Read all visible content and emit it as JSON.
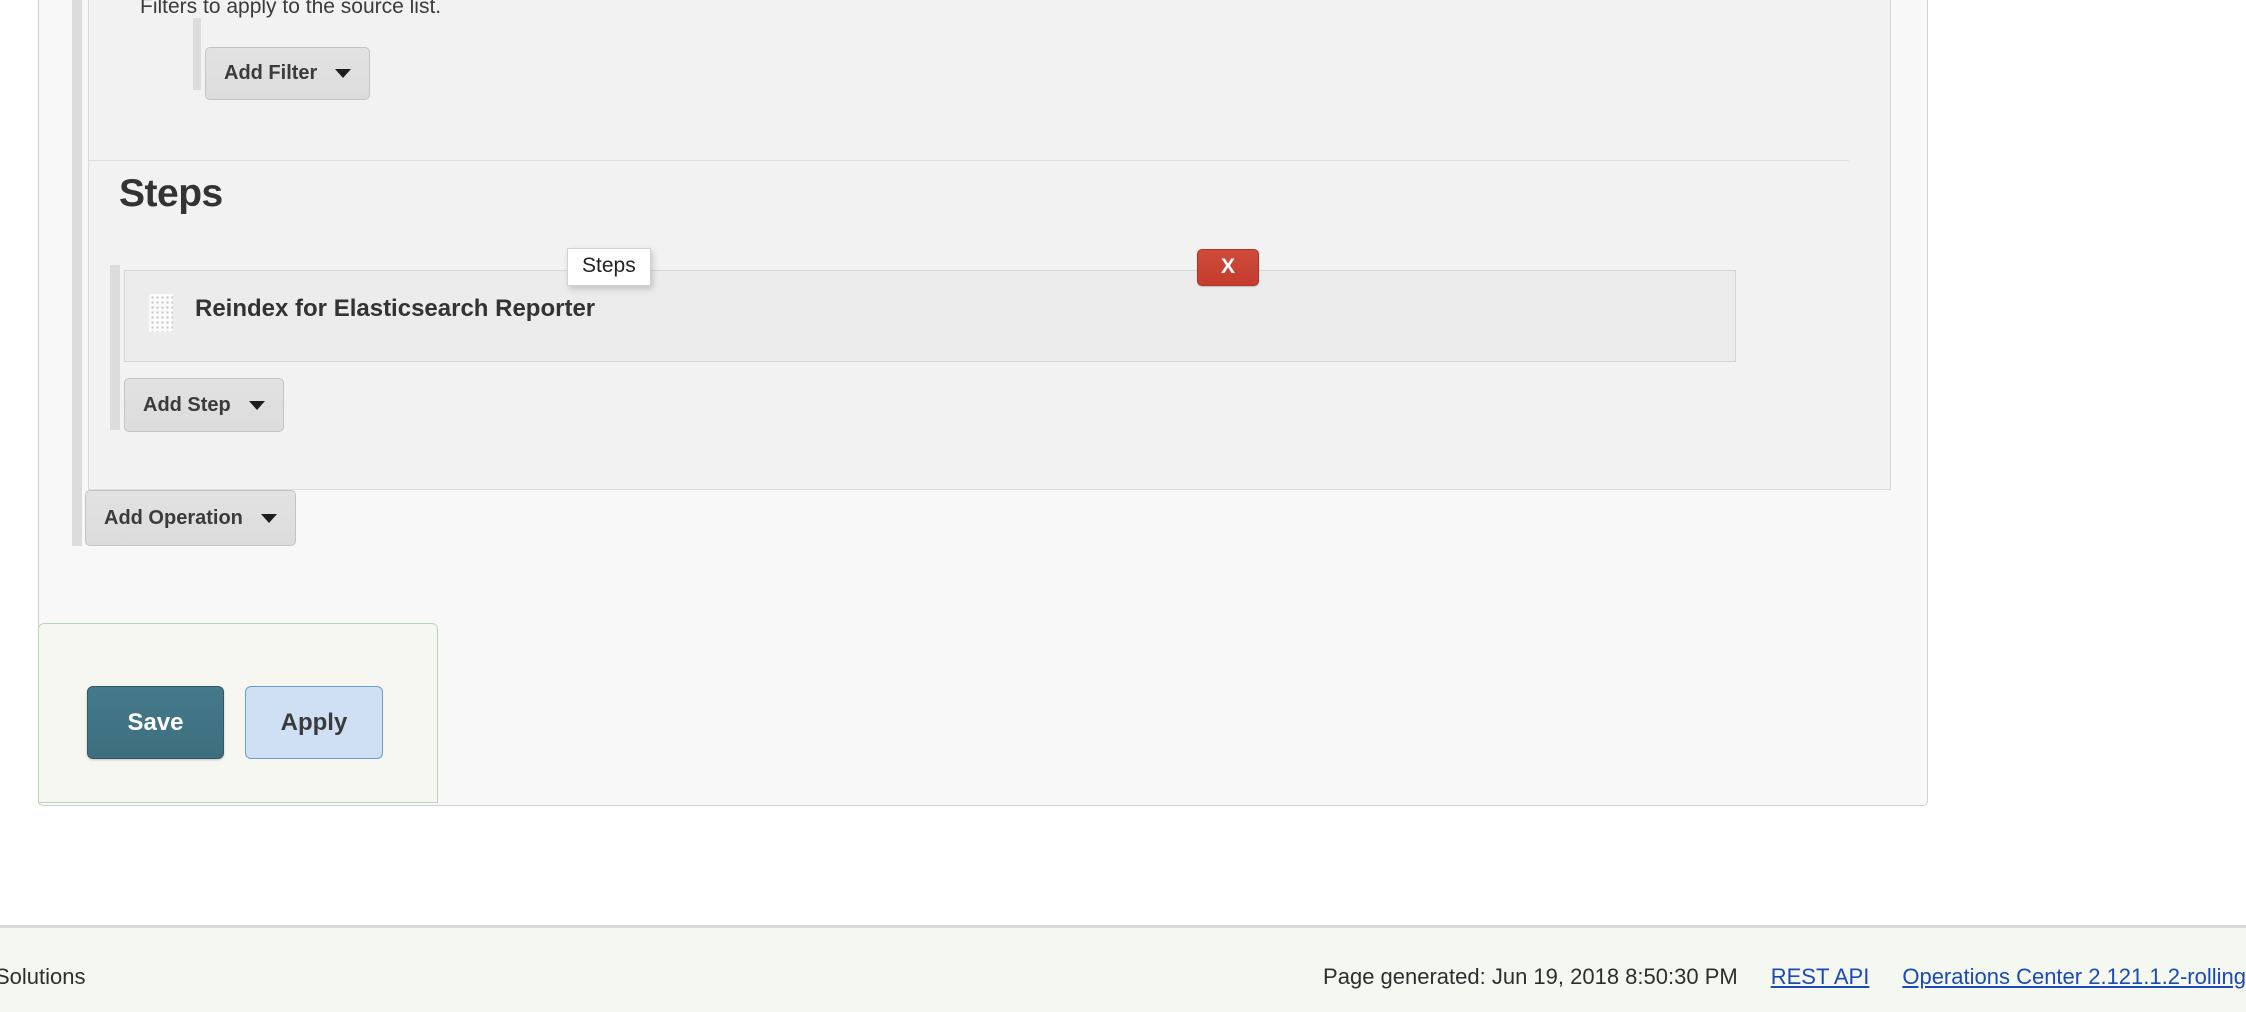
{
  "panel": {
    "filters_help": "Filters to apply to the source list.",
    "add_filter_label": "Add Filter",
    "steps_heading": "Steps",
    "add_step_label": "Add Step",
    "add_operation_label": "Add Operation",
    "steps": [
      {
        "name": "Reindex for Elasticsearch Reporter",
        "delete_label": "X"
      }
    ]
  },
  "tooltip": {
    "text": "Steps"
  },
  "save_bar": {
    "save_label": "Save",
    "apply_label": "Apply"
  },
  "footer": {
    "left_text": "Solutions",
    "page_generated": "Page generated: Jun 19, 2018 8:50:30 PM",
    "rest_api_label": "REST API",
    "version_label": "Operations Center 2.121.1.2-rolling"
  },
  "colors": {
    "save_button": "#3d6e7d",
    "apply_button": "#cfe0f5",
    "delete_button": "#c43c2d",
    "link": "#1b49b5",
    "footer_background": "#f5f8f1",
    "save_bar_border": "#bcd4bc",
    "panel_background": "#f2f2f2"
  }
}
